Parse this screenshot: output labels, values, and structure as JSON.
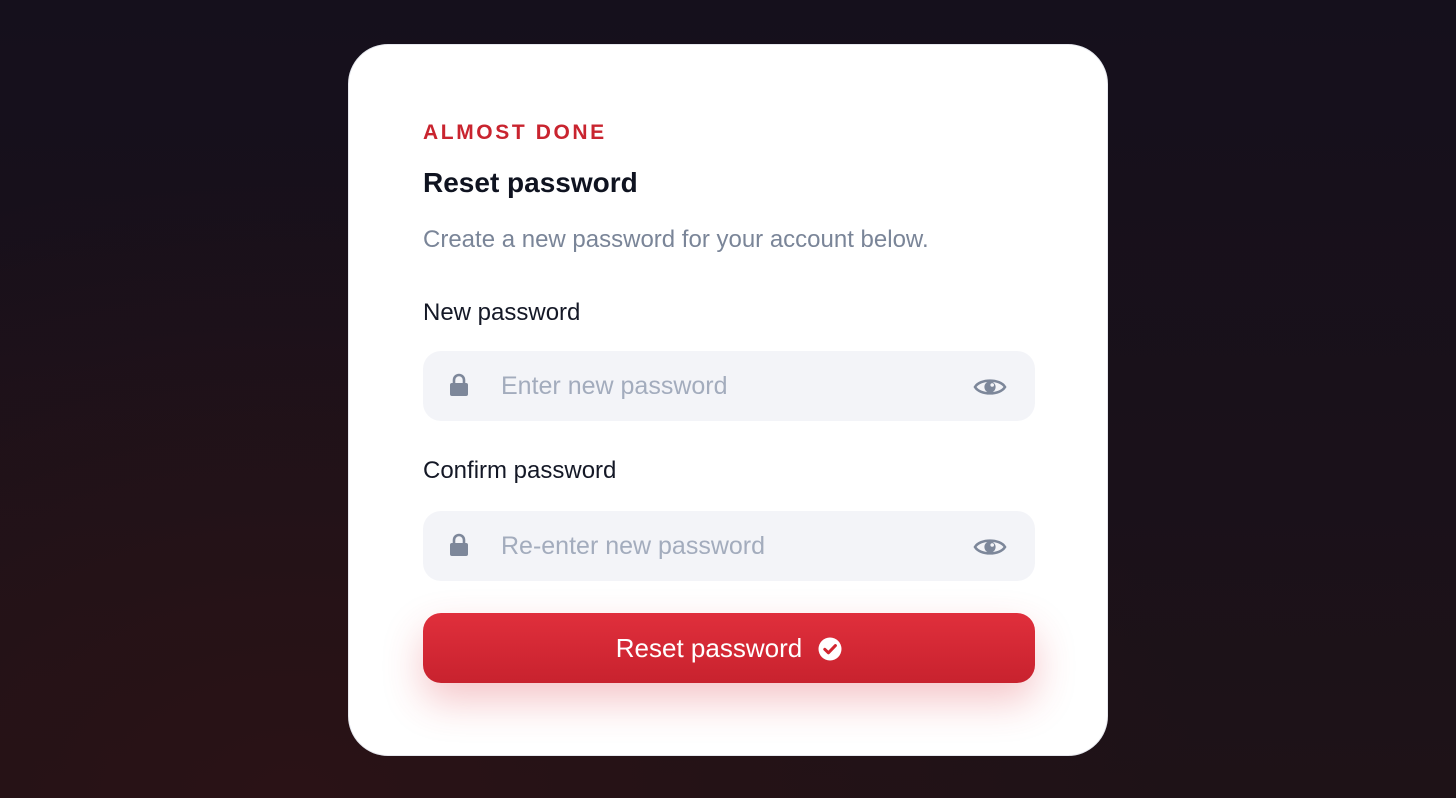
{
  "card": {
    "eyebrow": "ALMOST DONE",
    "title": "Reset password",
    "subtitle": "Create a new password for your account below."
  },
  "new_password": {
    "label": "New password",
    "placeholder": "Enter new password",
    "value": "",
    "leading_icon": "lock-icon",
    "trailing_icon": "eye-icon"
  },
  "confirm_password": {
    "label": "Confirm password",
    "placeholder": "Re-enter new password",
    "value": "",
    "leading_icon": "lock-icon",
    "trailing_icon": "eye-icon"
  },
  "submit": {
    "label": "Reset password",
    "icon": "check-circle-icon"
  },
  "colors": {
    "accent": "#c9242f",
    "button": "#d9293a",
    "field_bg": "#f3f4f8",
    "background": "#17101b"
  }
}
